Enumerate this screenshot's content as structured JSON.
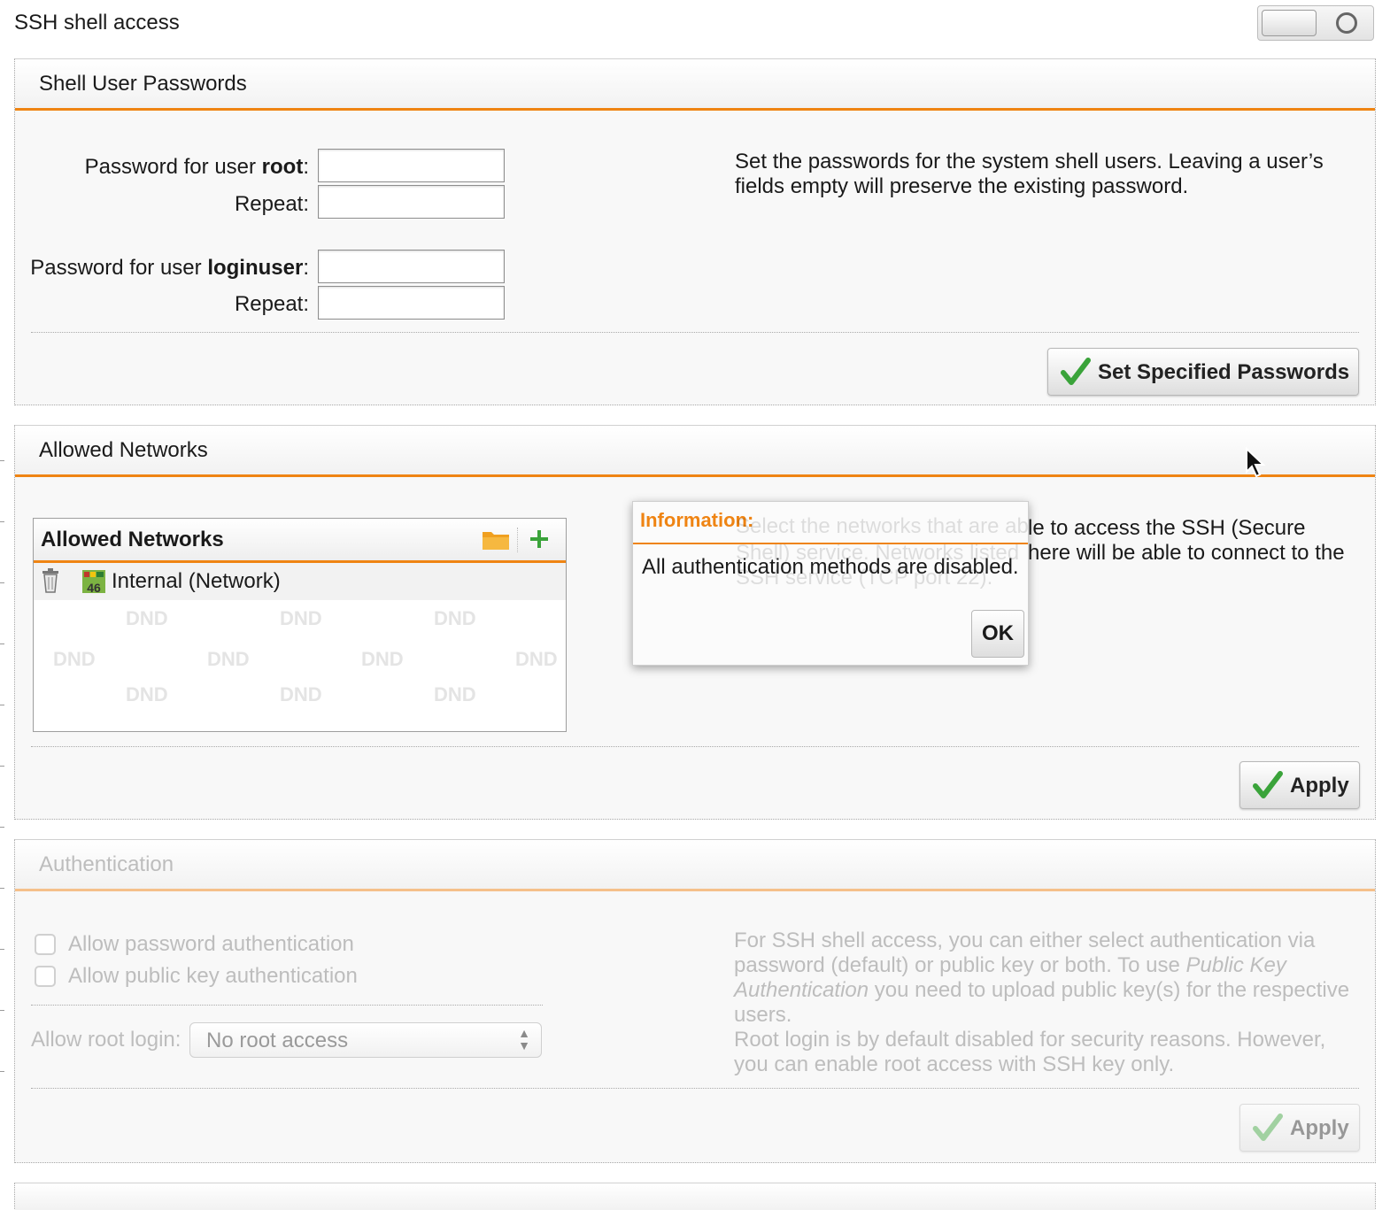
{
  "header": {
    "title": "SSH shell access",
    "toggle_state": "off"
  },
  "passwords_panel": {
    "title": "Shell User Passwords",
    "root_label_prefix": "Password for user ",
    "root_user": "root",
    "loginuser_label_prefix": "Password for user ",
    "loginuser_user": "loginuser",
    "colon": ":",
    "repeat_label": "Repeat:",
    "description": "Set the passwords for the system shell users. Leaving a user’s fields empty will preserve the existing password.",
    "button_label": "Set Specified Passwords"
  },
  "networks_panel": {
    "title": "Allowed Networks",
    "list_title": "Allowed Networks",
    "items": [
      {
        "name": "Internal (Network)",
        "icon": "network-46-icon"
      }
    ],
    "dnd_label": "DND",
    "description_visible": "le to access the SSH (Secure",
    "description_visible_2": "here will be able to connect to the",
    "description_hidden_1": "Select the networks that are ab",
    "description_hidden_2": "Shell) service. Networks listed",
    "description_hidden_3": "SSH service (TCP port 22).",
    "apply_label": "Apply"
  },
  "dialog": {
    "title": "Information:",
    "message": "All authentication methods are disabled.",
    "ok_label": "OK"
  },
  "auth_panel": {
    "title": "Authentication",
    "allow_password_label": "Allow password authentication",
    "allow_pubkey_label": "Allow public key authentication",
    "root_login_label": "Allow root login:",
    "root_login_value": "No root access",
    "desc_1": "For SSH shell access, you can either select authentication via password (default) or public key or both. To use ",
    "desc_em": "Public Key Authentication",
    "desc_2": " you need to upload public key(s) for the respective users.",
    "desc_3": "Root login is by default disabled for security reasons. However, you can enable root access with SSH key only.",
    "apply_label": "Apply"
  },
  "colors": {
    "accent": "#ef8413",
    "check_green": "#3aa33a",
    "disabled_text": "#bdbdbd"
  }
}
